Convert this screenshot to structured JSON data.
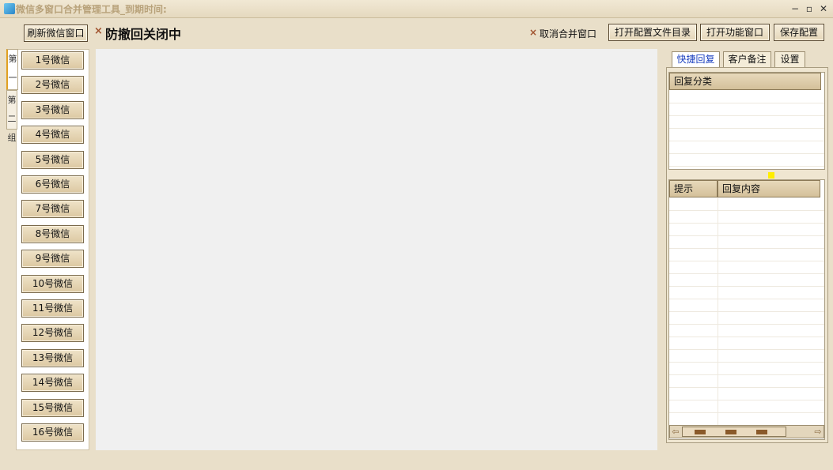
{
  "titlebar": {
    "title": "微信多窗口合并管理工具_到期时间:",
    "minimize": "−",
    "maximize": "▫",
    "close": "✕"
  },
  "toolbar": {
    "refresh_label": "刷新微信窗口",
    "anti_recall_icon": "×",
    "anti_recall_status": "防撤回关闭中",
    "cancel_merge_icon": "×",
    "cancel_merge_label": "取消合并窗口",
    "open_config_dir_label": "打开配置文件目录",
    "open_function_window_label": "打开功能窗口",
    "save_config_label": "保存配置"
  },
  "groups": [
    {
      "label": "第一组",
      "active": true
    },
    {
      "label": "第二组",
      "active": false
    }
  ],
  "wechat_buttons": [
    "1号微信",
    "2号微信",
    "3号微信",
    "4号微信",
    "5号微信",
    "6号微信",
    "7号微信",
    "8号微信",
    "9号微信",
    "10号微信",
    "11号微信",
    "12号微信",
    "13号微信",
    "14号微信",
    "15号微信",
    "16号微信"
  ],
  "right_panel": {
    "tabs": [
      {
        "label": "快捷回复",
        "active": true
      },
      {
        "label": "客户备注",
        "active": false
      },
      {
        "label": "设置",
        "active": false
      }
    ],
    "category_grid": {
      "header": "回复分类"
    },
    "reply_grid": {
      "headers": [
        "提示",
        "回复内容"
      ]
    },
    "scroll_left_icon": "⇦",
    "scroll_right_icon": "⇨"
  },
  "colors": {
    "accent": "#1a3fbf",
    "splitter": "#ffee00",
    "background": "#e9dfc9"
  }
}
